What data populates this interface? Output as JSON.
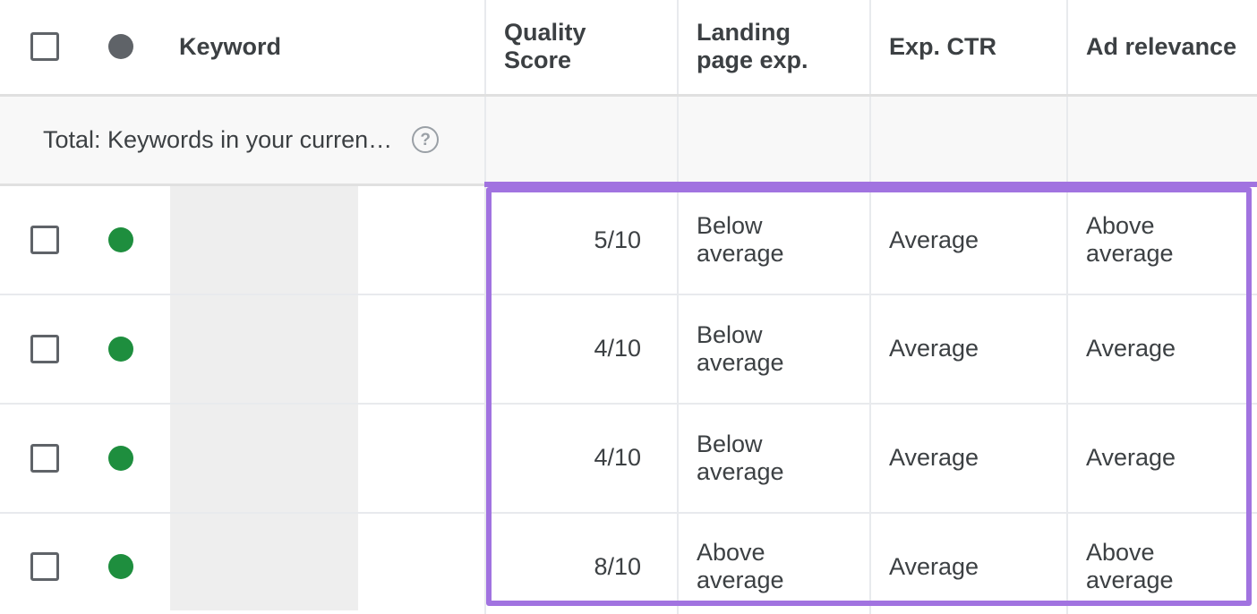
{
  "columns": {
    "keyword": "Keyword",
    "quality_score": "Quality Score",
    "landing_page_exp": "Landing page exp.",
    "exp_ctr": "Exp. CTR",
    "ad_relevance": "Ad relevance"
  },
  "total_row": {
    "label": "Total: Keywords in your curren…",
    "help_glyph": "?"
  },
  "rows": [
    {
      "quality_score": "5/10",
      "landing_page_exp": "Below average",
      "exp_ctr": "Average",
      "ad_relevance": "Above average"
    },
    {
      "quality_score": "4/10",
      "landing_page_exp": "Below average",
      "exp_ctr": "Average",
      "ad_relevance": "Average"
    },
    {
      "quality_score": "4/10",
      "landing_page_exp": "Below average",
      "exp_ctr": "Average",
      "ad_relevance": "Average"
    },
    {
      "quality_score": "8/10",
      "landing_page_exp": "Above average",
      "exp_ctr": "Average",
      "ad_relevance": "Above average"
    }
  ]
}
